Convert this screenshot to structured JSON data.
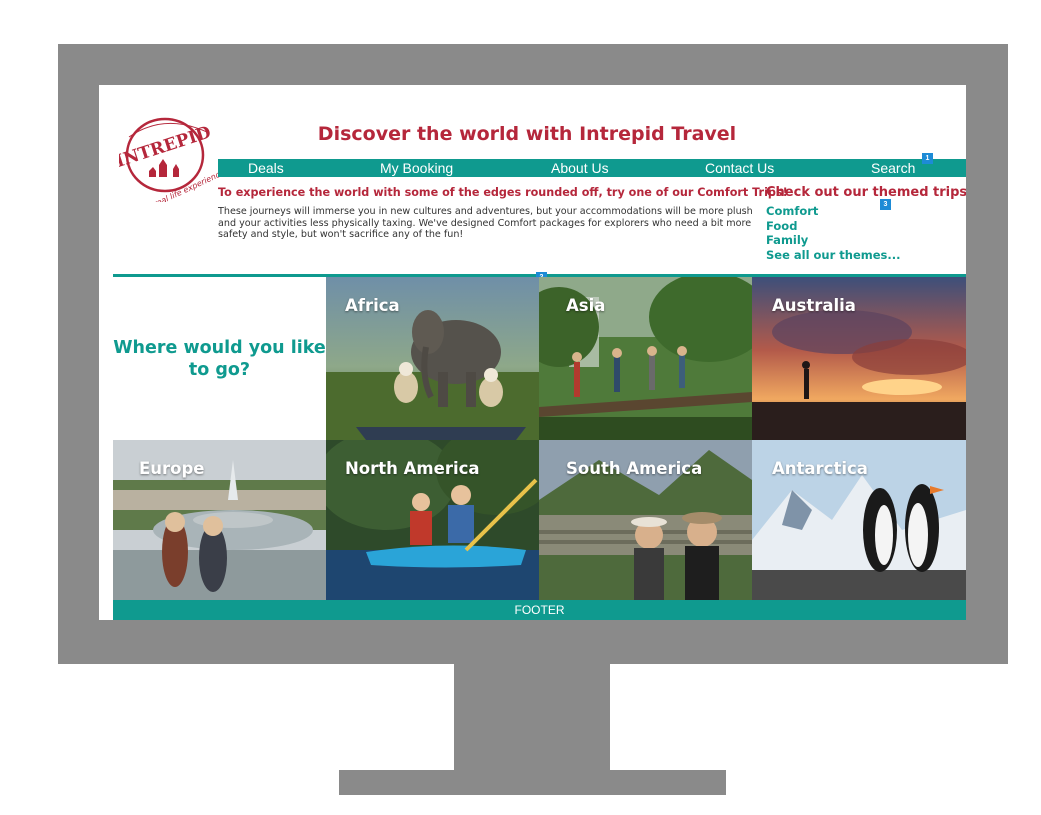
{
  "header": {
    "logo_text": "INTREPID",
    "logo_tagline": "real life experiences...",
    "title": "Discover the world with Intrepid Travel"
  },
  "nav": {
    "items": [
      {
        "label": "Deals"
      },
      {
        "label": "My Booking"
      },
      {
        "label": "About Us"
      },
      {
        "label": "Contact Us"
      },
      {
        "label": "Search"
      }
    ]
  },
  "badges": [
    "1",
    "2",
    "3"
  ],
  "intro": {
    "heading": "To experience the world with some of the edges rounded off, try one of our Comfort Trips!",
    "body": "These journeys will immerse you in new cultures and adventures, but your accommodations will be more plush and your activities less physically taxing. We've designed Comfort packages for explorers who need a bit more safety and style, but won't sacrifice any of the fun!"
  },
  "themes": {
    "heading": "Check out our themed trips!",
    "links": [
      "Comfort",
      "Food",
      "Family",
      "See all our themes..."
    ]
  },
  "destinations": {
    "prompt": "Where would you like to go?",
    "tiles": [
      {
        "label": "Africa"
      },
      {
        "label": "Asia"
      },
      {
        "label": "Australia"
      },
      {
        "label": "Europe"
      },
      {
        "label": "North America"
      },
      {
        "label": "South America"
      },
      {
        "label": "Antarctica"
      }
    ]
  },
  "footer": {
    "label": "FOOTER"
  },
  "colors": {
    "brand_red": "#b5273b",
    "brand_teal": "#0f9a8f",
    "badge_blue": "#1d8bd6",
    "monitor_gray": "#8a8a8a"
  }
}
